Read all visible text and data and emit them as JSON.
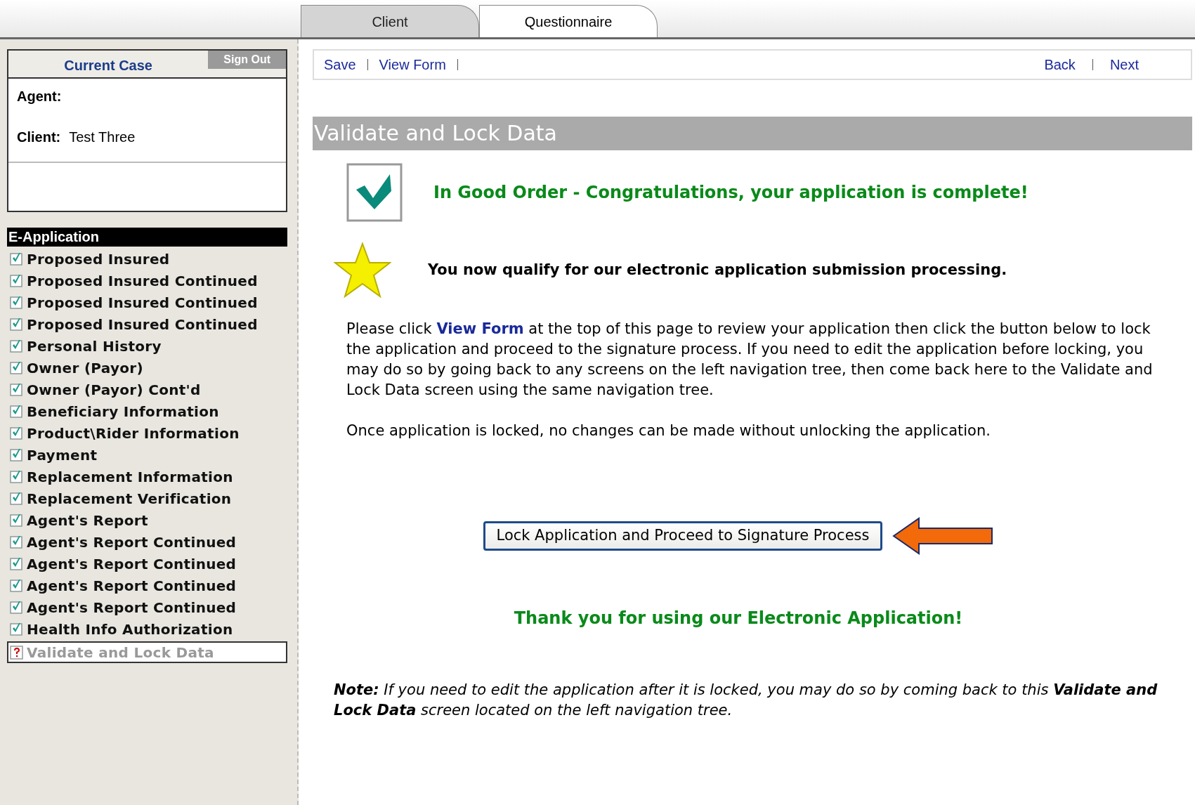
{
  "tabs": [
    {
      "label": "Client",
      "selected": false
    },
    {
      "label": "Questionnaire",
      "selected": true
    }
  ],
  "case_panel": {
    "title": "Current Case",
    "sign_out": "Sign Out",
    "agent_label": "Agent:",
    "client_label": "Client:",
    "client_value": "Test Three"
  },
  "nav": {
    "heading": "E-Application",
    "items": [
      {
        "label": "Proposed Insured",
        "checked": true,
        "selected": false
      },
      {
        "label": "Proposed Insured Continued",
        "checked": true,
        "selected": false
      },
      {
        "label": "Proposed Insured Continued",
        "checked": true,
        "selected": false
      },
      {
        "label": "Proposed Insured Continued",
        "checked": true,
        "selected": false
      },
      {
        "label": "Personal History",
        "checked": true,
        "selected": false
      },
      {
        "label": "Owner (Payor)",
        "checked": true,
        "selected": false
      },
      {
        "label": "Owner (Payor) Cont'd",
        "checked": true,
        "selected": false
      },
      {
        "label": "Beneficiary Information",
        "checked": true,
        "selected": false
      },
      {
        "label": "Product\\Rider Information",
        "checked": true,
        "selected": false
      },
      {
        "label": "Payment",
        "checked": true,
        "selected": false
      },
      {
        "label": "Replacement Information",
        "checked": true,
        "selected": false
      },
      {
        "label": "Replacement Verification",
        "checked": true,
        "selected": false
      },
      {
        "label": "Agent's Report",
        "checked": true,
        "selected": false
      },
      {
        "label": "Agent's Report Continued",
        "checked": true,
        "selected": false
      },
      {
        "label": "Agent's Report Continued",
        "checked": true,
        "selected": false
      },
      {
        "label": "Agent's Report Continued",
        "checked": true,
        "selected": false
      },
      {
        "label": "Agent's Report Continued",
        "checked": true,
        "selected": false
      },
      {
        "label": "Health Info Authorization",
        "checked": true,
        "selected": false
      },
      {
        "label": "Validate and Lock Data",
        "checked": false,
        "selected": true
      }
    ]
  },
  "toolbar": {
    "left": [
      "Save",
      "View Form"
    ],
    "right": [
      "Back",
      "Next"
    ]
  },
  "page_title": "Validate and Lock Data",
  "status_message": "In Good Order - Congratulations, your application is complete!",
  "qualify_message": "You now qualify for our electronic application submission processing.",
  "instructions": {
    "before": "Please click ",
    "link": "View Form",
    "after": " at the top of this page to review your application then click the button below to lock the application and proceed to the signature process. If you need to edit the application before locking, you may do so by going back to any screens on the left navigation tree, then come back here to the Validate and Lock Data screen using the same navigation tree."
  },
  "lock_notice": "Once application is locked, no changes can be made without unlocking the application.",
  "lock_button": "Lock Application and Proceed to Signature Process",
  "thanks": "Thank you for using our Electronic Application!",
  "note": "**Note:** If you need to edit the application after it is locked, you may do so by coming back to this **Validate and Lock Data** screen located on the left navigation tree."
}
